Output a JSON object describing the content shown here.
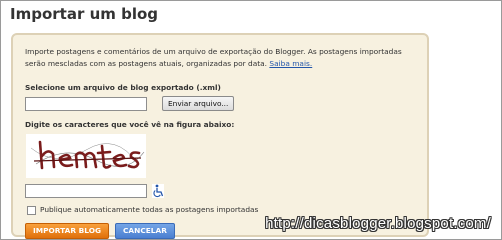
{
  "page": {
    "title": "Importar um blog"
  },
  "description": {
    "text": "Importe postagens e comentários de um arquivo de exportação do Blogger. As postagens importadas serão mescladas com as postagens atuais, organizadas por data.",
    "link": "Saiba mais."
  },
  "file_section": {
    "label": "Selecione um arquivo de blog exportado (.xml)",
    "file_value": "",
    "browse_button": "Enviar arquivo..."
  },
  "captcha": {
    "label": "Digite os caracteres que você vê na figura abaixo:",
    "image_text": "hemtes",
    "input_value": "",
    "accessibility_icon": "wheelchair-icon"
  },
  "options": {
    "auto_publish_label": "Publique automaticamente todas as postagens importadas",
    "auto_publish_checked": false
  },
  "actions": {
    "import_label": "IMPORTAR BLOG",
    "cancel_label": "CANCELAR"
  },
  "watermark": "http://dicasblogger.blogspot.com/",
  "colors": {
    "import_button": "#e8820f",
    "cancel_button": "#5a8fdc",
    "panel_background": "#f7f1e0",
    "panel_border": "#ddd1b6",
    "link": "#2255aa"
  }
}
